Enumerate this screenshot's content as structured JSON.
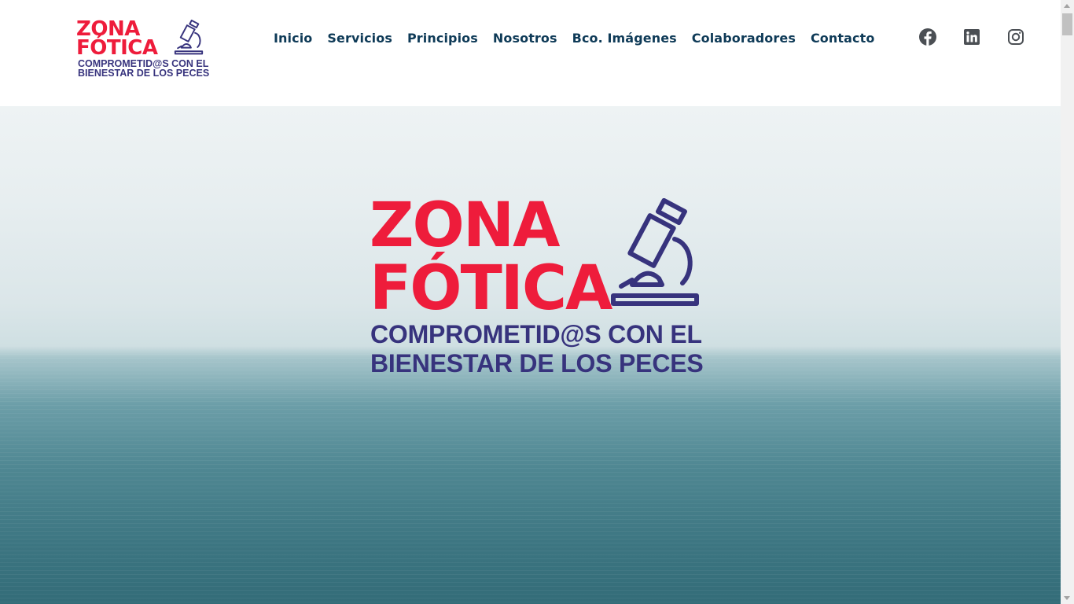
{
  "brand": {
    "line1": "ZONA",
    "line2": "FÓTICA",
    "tagline1": "COMPROMETID@S CON EL",
    "tagline2": "BIENESTAR DE LOS PECES",
    "logo_icon": "microscope-icon",
    "red": "#ee1c3b",
    "indigo": "#37337d"
  },
  "nav": {
    "items": [
      {
        "label": "Inicio"
      },
      {
        "label": "Servicios"
      },
      {
        "label": "Principios"
      },
      {
        "label": "Nosotros"
      },
      {
        "label": "Bco. Imágenes"
      },
      {
        "label": "Colaboradores"
      },
      {
        "label": "Contacto"
      }
    ],
    "color": "#0e3a57"
  },
  "social": [
    {
      "icon": "facebook-icon"
    },
    {
      "icon": "linkedin-icon"
    },
    {
      "icon": "instagram-icon"
    }
  ],
  "hero": {
    "line1": "ZONA",
    "line2": "FÓTICA",
    "tagline1": "COMPROMETID@S CON EL",
    "tagline2": "BIENESTAR DE LOS PECES",
    "background": "ocean-photo",
    "sky_color": "#e7eef0",
    "sea_color": "#3c7581"
  }
}
